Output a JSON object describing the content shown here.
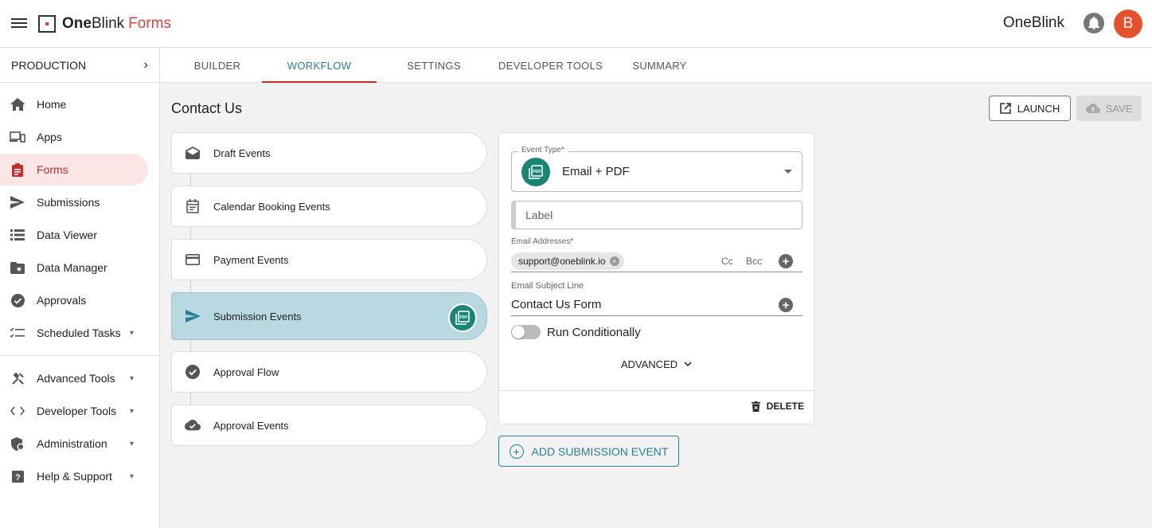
{
  "app": {
    "brand_one": "One",
    "brand_blink": "Blink",
    "brand_forms": "Forms",
    "org_name": "OneBlink",
    "avatar_initial": "B",
    "accent_color": "#c0312d",
    "teal_color": "#2a7e97"
  },
  "sidebar": {
    "environment": "PRODUCTION",
    "items": [
      {
        "label": "Home",
        "icon": "home-icon"
      },
      {
        "label": "Apps",
        "icon": "devices-icon"
      },
      {
        "label": "Forms",
        "icon": "clipboard-icon",
        "active": true
      },
      {
        "label": "Submissions",
        "icon": "send-icon"
      },
      {
        "label": "Data Viewer",
        "icon": "list-icon"
      },
      {
        "label": "Data Manager",
        "icon": "folder-star-icon"
      },
      {
        "label": "Approvals",
        "icon": "check-circle-icon"
      },
      {
        "label": "Scheduled Tasks",
        "icon": "checklist-icon"
      }
    ],
    "secondary_items": [
      {
        "label": "Advanced Tools",
        "icon": "tools-icon"
      },
      {
        "label": "Developer Tools",
        "icon": "code-icon"
      },
      {
        "label": "Administration",
        "icon": "admin-icon"
      },
      {
        "label": "Help & Support",
        "icon": "help-icon"
      }
    ]
  },
  "tabs": [
    {
      "label": "BUILDER"
    },
    {
      "label": "WORKFLOW",
      "active": true
    },
    {
      "label": "SETTINGS"
    },
    {
      "label": "DEVELOPER TOOLS"
    },
    {
      "label": "SUMMARY"
    }
  ],
  "page": {
    "title": "Contact Us",
    "launch_label": "LAUNCH",
    "save_label": "SAVE"
  },
  "events": [
    {
      "label": "Draft Events",
      "icon": "drafts-icon"
    },
    {
      "label": "Calendar Booking Events",
      "icon": "calendar-icon"
    },
    {
      "label": "Payment Events",
      "icon": "credit-card-icon"
    },
    {
      "label": "Submission Events",
      "icon": "send-icon",
      "active": true
    },
    {
      "label": "Approval Flow",
      "icon": "check-circle-icon"
    },
    {
      "label": "Approval Events",
      "icon": "cloud-check-icon"
    }
  ],
  "detail": {
    "event_type_label": "Event Type*",
    "event_type_value": "Email + PDF",
    "label_placeholder": "Label",
    "email_addresses_label": "Email Addresses*",
    "email_chip": "support@oneblink.io",
    "cc_label": "Cc",
    "bcc_label": "Bcc",
    "subject_label": "Email Subject Line",
    "subject_value": "Contact Us Form",
    "run_conditionally_label": "Run Conditionally",
    "advanced_label": "ADVANCED",
    "delete_label": "DELETE"
  },
  "add_event_label": "ADD SUBMISSION EVENT"
}
